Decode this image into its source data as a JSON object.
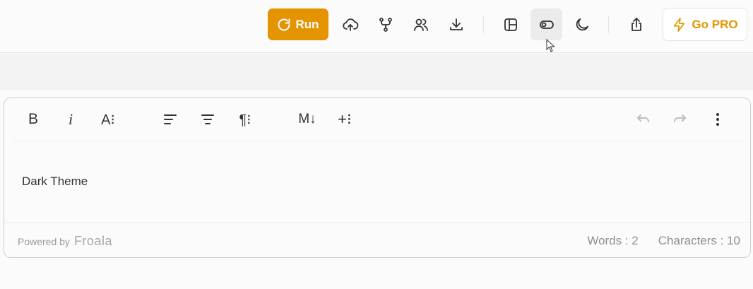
{
  "topbar": {
    "run_label": "Run",
    "gopro_label": "Go PRO",
    "icons": [
      "upload-cloud-icon",
      "fork-icon",
      "users-icon",
      "download-icon",
      "layout-icon",
      "toggle-icon",
      "moon-icon",
      "share-icon"
    ]
  },
  "editor": {
    "toolbar": {
      "bold": "B",
      "italic": "i",
      "font_size": "A⁝",
      "paragraph": "¶⁝",
      "markdown": "M↓",
      "insert": "+⁝"
    },
    "content": "Dark Theme",
    "footer": {
      "powered_by": "Powered by",
      "brand": "Froala",
      "words": "Words : 2",
      "characters": "Characters : 10"
    }
  },
  "colors": {
    "accent": "#e39400",
    "active_bg": "#ebebeb"
  }
}
